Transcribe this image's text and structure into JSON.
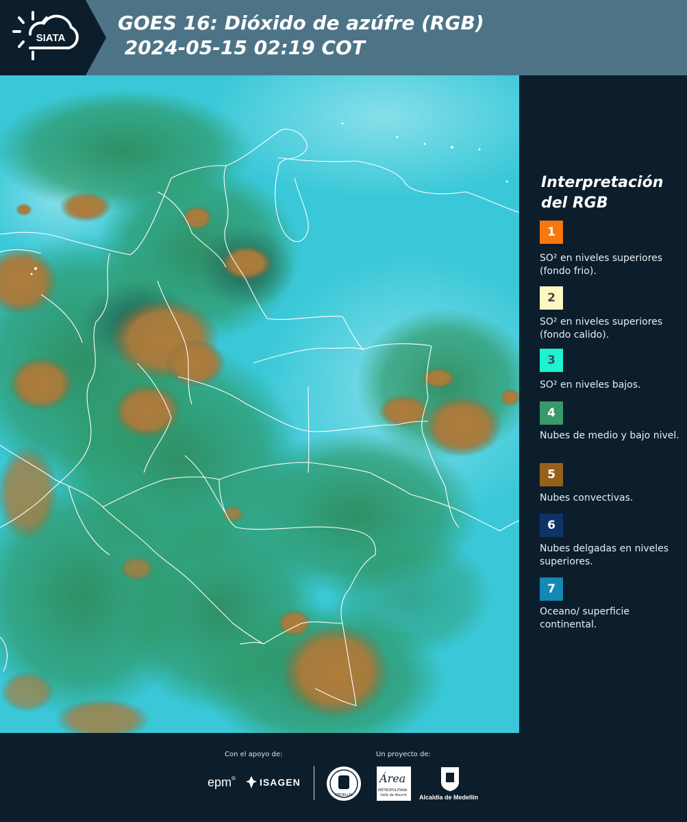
{
  "header": {
    "logo_text": "SIATA",
    "title_line1": "GOES 16: Dióxido de azúfre (RGB)",
    "title_line2": " 2024-05-15 02:19 COT"
  },
  "legend": {
    "title_line1": "Interpretación",
    "title_line2": "del RGB",
    "items": [
      {
        "number": "1",
        "color": "#f7780e",
        "text_color": "#ffffff",
        "label": "SO² en niveles superiores (fondo frio)."
      },
      {
        "number": "2",
        "color": "#fdf7c4",
        "text_color": "#444444",
        "label": "SO² en niveles superiores (fondo calido)."
      },
      {
        "number": "3",
        "color": "#1ef2d2",
        "text_color": "#30505a",
        "label": "SO² en niveles bajos."
      },
      {
        "number": "4",
        "color": "#3b9868",
        "text_color": "#ffffff",
        "label": "Nubes de medio y bajo nivel."
      },
      {
        "number": "5",
        "color": "#96611a",
        "text_color": "#ffffff",
        "label": "Nubes convectivas."
      },
      {
        "number": "6",
        "color": "#0f3366",
        "text_color": "#ffffff",
        "label": "Nubes delgadas en niveles superiores."
      },
      {
        "number": "7",
        "color": "#1389b4",
        "text_color": "#ffffff",
        "label": "Oceano/ superficie continental."
      }
    ]
  },
  "footer": {
    "support_label": "Con el apoyo de:",
    "project_label": "Un proyecto de:",
    "epm_text": "epm",
    "isagen_text": "ISAGEN",
    "area_text": "Área",
    "area_sub1": "METROPOLITANA",
    "area_sub2": "Valle de Aburrá",
    "alcaldia_text": "Alcaldía de Medellín",
    "seal_text": "MEDELLÍN"
  }
}
